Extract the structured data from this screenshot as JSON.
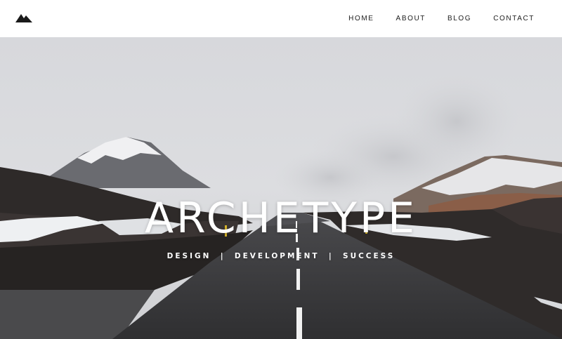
{
  "nav": {
    "logo_icon": "mountain-logo-icon",
    "items": [
      {
        "label": "HOME"
      },
      {
        "label": "ABOUT"
      },
      {
        "label": "BLOG"
      },
      {
        "label": "CONTACT"
      }
    ]
  },
  "hero": {
    "title": "ARCHETYPE",
    "tagline": "DESIGN  |  DEVELOPMENT  |  SUCCESS",
    "colors": {
      "text": "#ffffff",
      "sky": "#d9dadd",
      "road": "#3a3a3c"
    }
  }
}
